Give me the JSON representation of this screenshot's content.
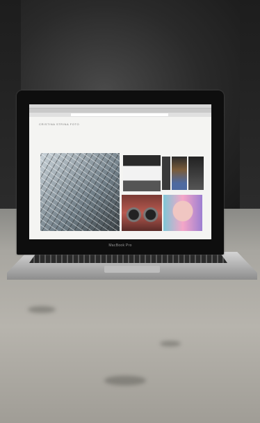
{
  "image": {
    "subject": "open laptop on concrete floor in a dark interior",
    "laptop_brand_text": "MacBook Pro",
    "screen_site_title": "CRISTINA STRINA FOTO",
    "colors": {
      "background_dark": "#1a1a1a",
      "floor": "#b7b4ad",
      "screen": "#f4f4f2"
    }
  }
}
